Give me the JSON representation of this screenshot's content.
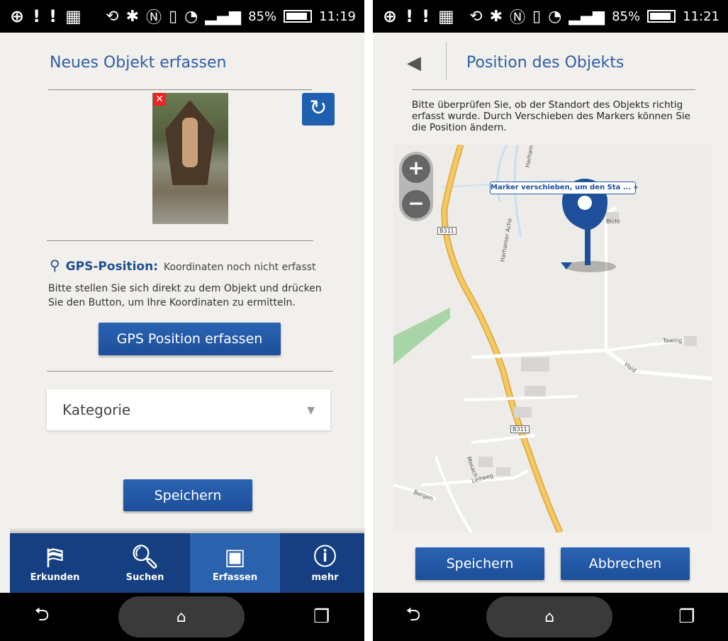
{
  "left": {
    "status": {
      "battery": "85%",
      "time": "11:19"
    },
    "title": "Neues Objekt erfassen",
    "gps_label": "GPS-Position:",
    "gps_status": "Koordinaten noch nicht erfasst",
    "gps_help": "Bitte stellen Sie sich direkt zu dem Objekt und drücken Sie den Button, um Ihre Koordinaten zu ermitteln.",
    "gps_button": "GPS Position erfassen",
    "category_placeholder": "Kategorie",
    "save_button": "Speichern",
    "tabs": [
      {
        "label": "Erkunden",
        "icon": "map-pin-icon"
      },
      {
        "label": "Suchen",
        "icon": "search-icon"
      },
      {
        "label": "Erfassen",
        "icon": "camera-icon"
      },
      {
        "label": "mehr",
        "icon": "info-icon"
      }
    ]
  },
  "right": {
    "status": {
      "battery": "85%",
      "time": "11:21"
    },
    "title": "Position des Objekts",
    "description": "Bitte überprüfen Sie, ob der Standort des Objekts richtig erfasst wurde. Durch Verschieben des Markers können Sie die Position ändern.",
    "marker_tooltip": "Marker verschieben, um den Sta ... »",
    "map_labels": [
      "B311",
      "B311",
      "Bichl",
      "Tawing",
      "Harham",
      "Harhamer Ache",
      "Bergen",
      "Mosach",
      "Leitweg",
      "Haid"
    ],
    "save_button": "Speichern",
    "cancel_button": "Abbrechen"
  },
  "colors": {
    "accent": "#2d5fa6",
    "button": "#1f55a3",
    "tabbar": "#153f80",
    "road": "#f2c05a"
  }
}
